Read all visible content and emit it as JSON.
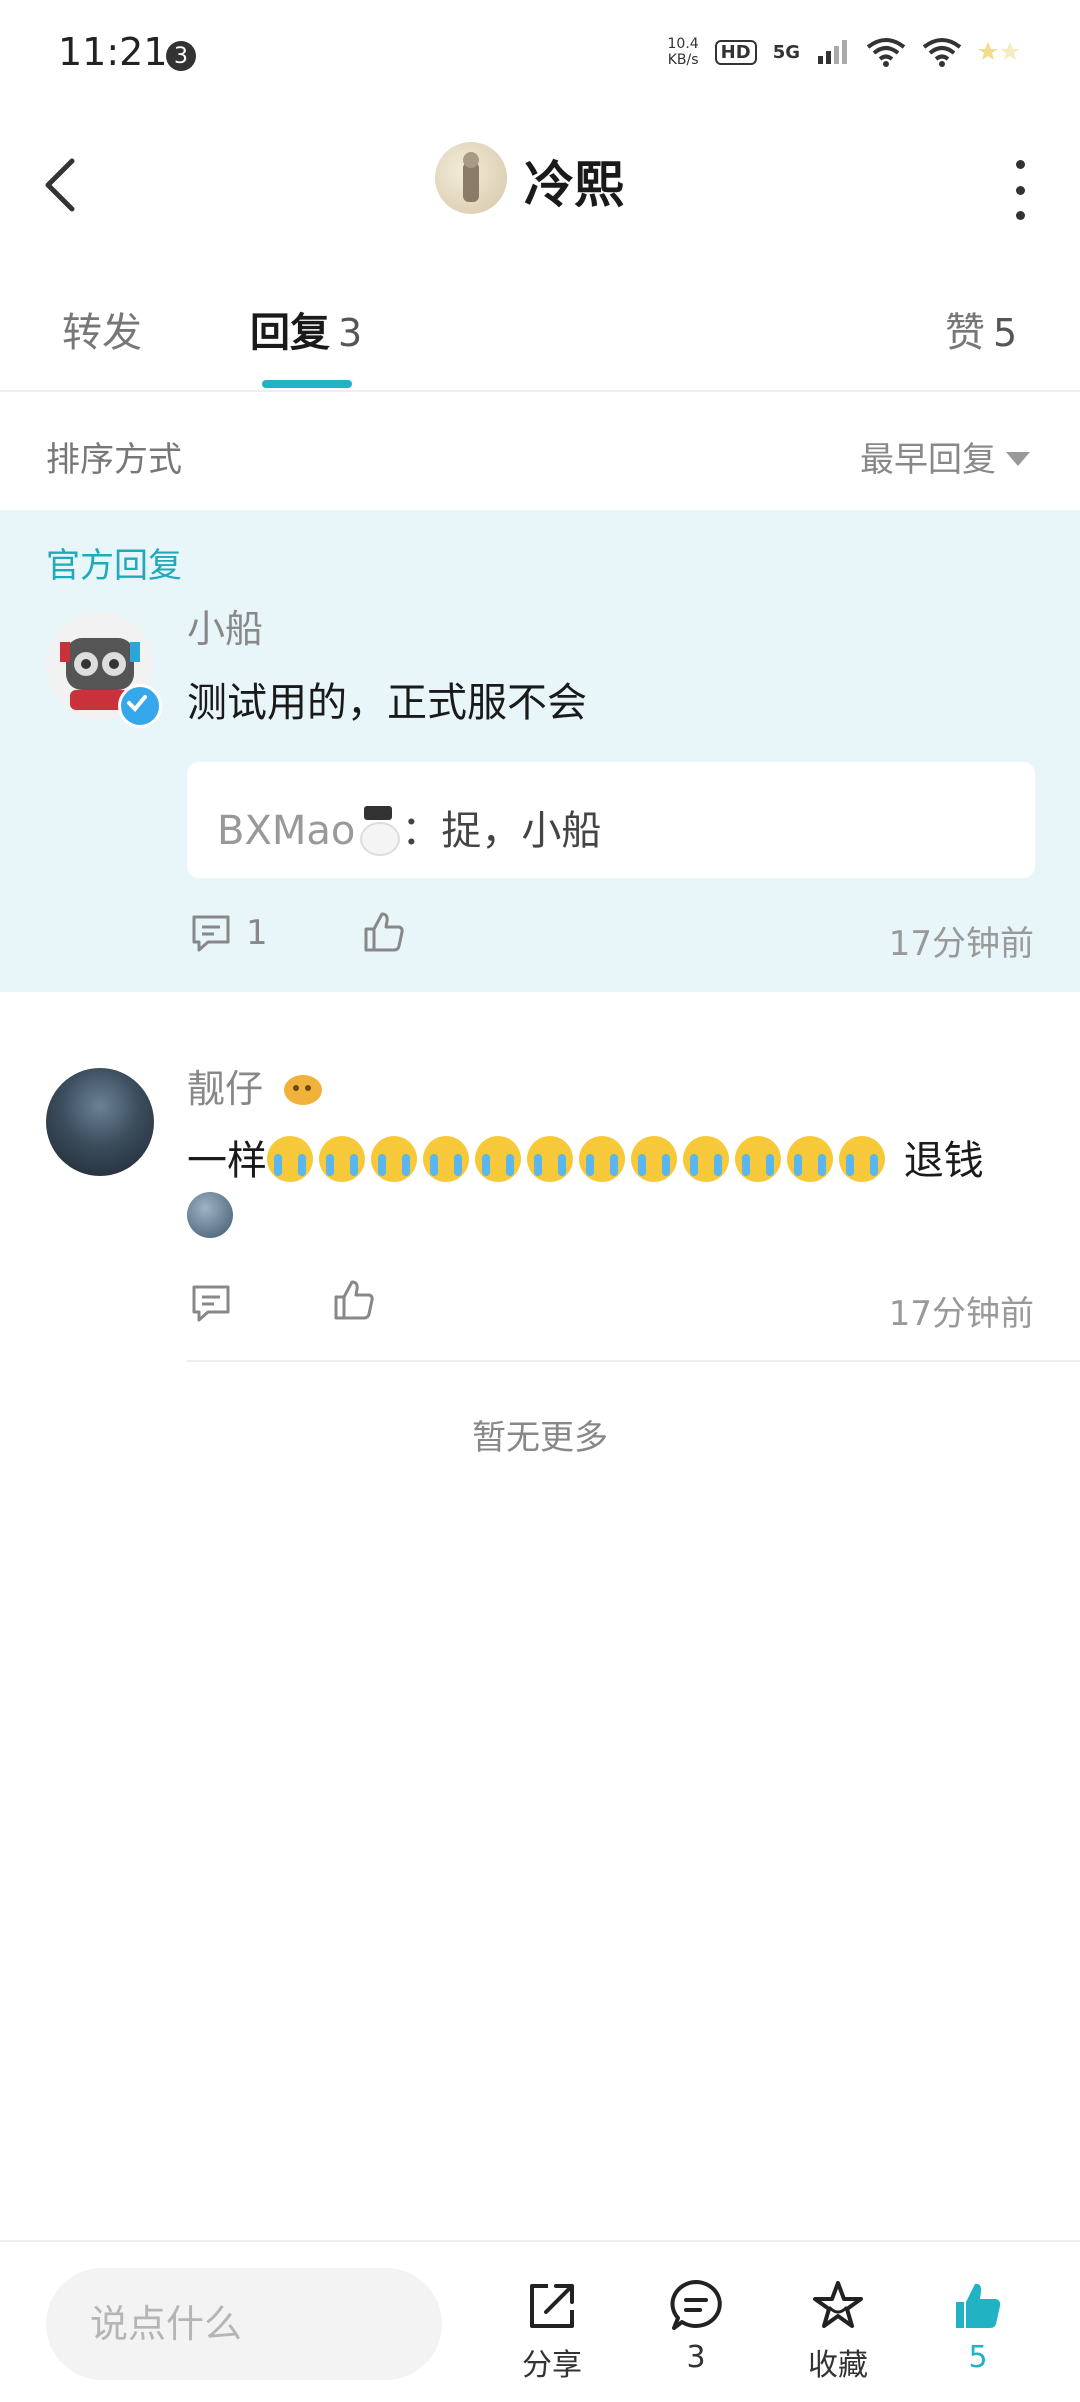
{
  "status_bar": {
    "time": "11:21",
    "notification_count": "3",
    "net_speed": "10.4",
    "net_speed_unit": "KB/s",
    "hd": "HD",
    "network": "5G"
  },
  "header": {
    "title": "冷熙"
  },
  "tabs": [
    {
      "label": "转发",
      "count": ""
    },
    {
      "label": "回复",
      "count": "3"
    },
    {
      "label": "赞",
      "count": "5"
    }
  ],
  "sort": {
    "label": "排序方式",
    "value": "最早回复"
  },
  "official_reply": {
    "tag": "官方回复",
    "user": "小船",
    "text": "测试用的，正式服不会",
    "quote_user": "BXMao",
    "quote_text": "：捉，小船",
    "comment_count": "1",
    "time": "17分钟前"
  },
  "reply2": {
    "user": "靓仔",
    "text_prefix": "一样",
    "text_suffix": "退钱",
    "time": "17分钟前"
  },
  "no_more": "暂无更多",
  "bottom_bar": {
    "input_placeholder": "说点什么",
    "share_label": "分享",
    "comment_count": "3",
    "collect_label": "收藏",
    "like_count": "5"
  },
  "colors": {
    "accent": "#21b3c4",
    "official_bg": "#e8f6f9"
  }
}
